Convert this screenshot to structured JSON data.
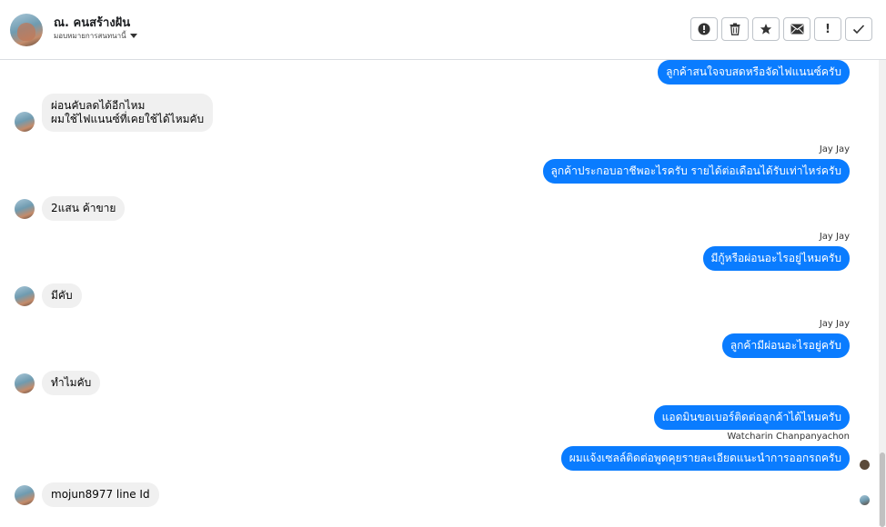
{
  "header": {
    "name": "ณ. คนสร้างฝัน",
    "subtitle": "มอบหมายการสนทนานี้"
  },
  "toolbar": {
    "buttons": [
      {
        "icon": "alert-circle-icon"
      },
      {
        "icon": "trash-icon"
      },
      {
        "icon": "star-icon"
      },
      {
        "icon": "envelope-icon"
      },
      {
        "icon": "exclamation-icon",
        "label": "!"
      },
      {
        "icon": "check-icon"
      }
    ]
  },
  "messages": [
    {
      "dir": "out",
      "text": "ลูกค้าสนใจจบสดหรือจัดไฟแนนซ์ครับ"
    },
    {
      "dir": "in",
      "text": "ผ่อนคับลดได้อีกไหม\nผมใช้ไฟแนนซ์ที่เคยใช้ได้ไหมคับ"
    },
    {
      "dir": "out",
      "sender": "Jay Jay",
      "text": "ลูกค้าประกอบอาชีพอะไรครับ รายได้ต่อเดือนได้รับเท่าไหร่ครับ"
    },
    {
      "dir": "in",
      "text": "2แสน ค้าขาย"
    },
    {
      "dir": "out",
      "sender": "Jay Jay",
      "text": "มีกู้หรือผ่อนอะไรอยู่ไหมครับ"
    },
    {
      "dir": "in",
      "text": "มีคับ"
    },
    {
      "dir": "out",
      "sender": "Jay Jay",
      "text": "ลูกค้ามีผ่อนอะไรอยู่ครับ"
    },
    {
      "dir": "in",
      "text": "ทำไมคับ"
    },
    {
      "dir": "out",
      "text": "แอดมินขอเบอร์ติดต่อลูกค้าได้ไหมครับ"
    },
    {
      "dir": "out",
      "sender": "Watcharin Chanpanyachon",
      "text": "ผมแจ้งเซลล์ติดต่อพูดคุยรายละเอียดแนะนำการออกรถครับ"
    },
    {
      "dir": "in",
      "text": "mojun8977 line Id"
    }
  ],
  "colors": {
    "outgoing_bubble": "#0a7cff",
    "incoming_bubble": "#f0f0f0"
  }
}
